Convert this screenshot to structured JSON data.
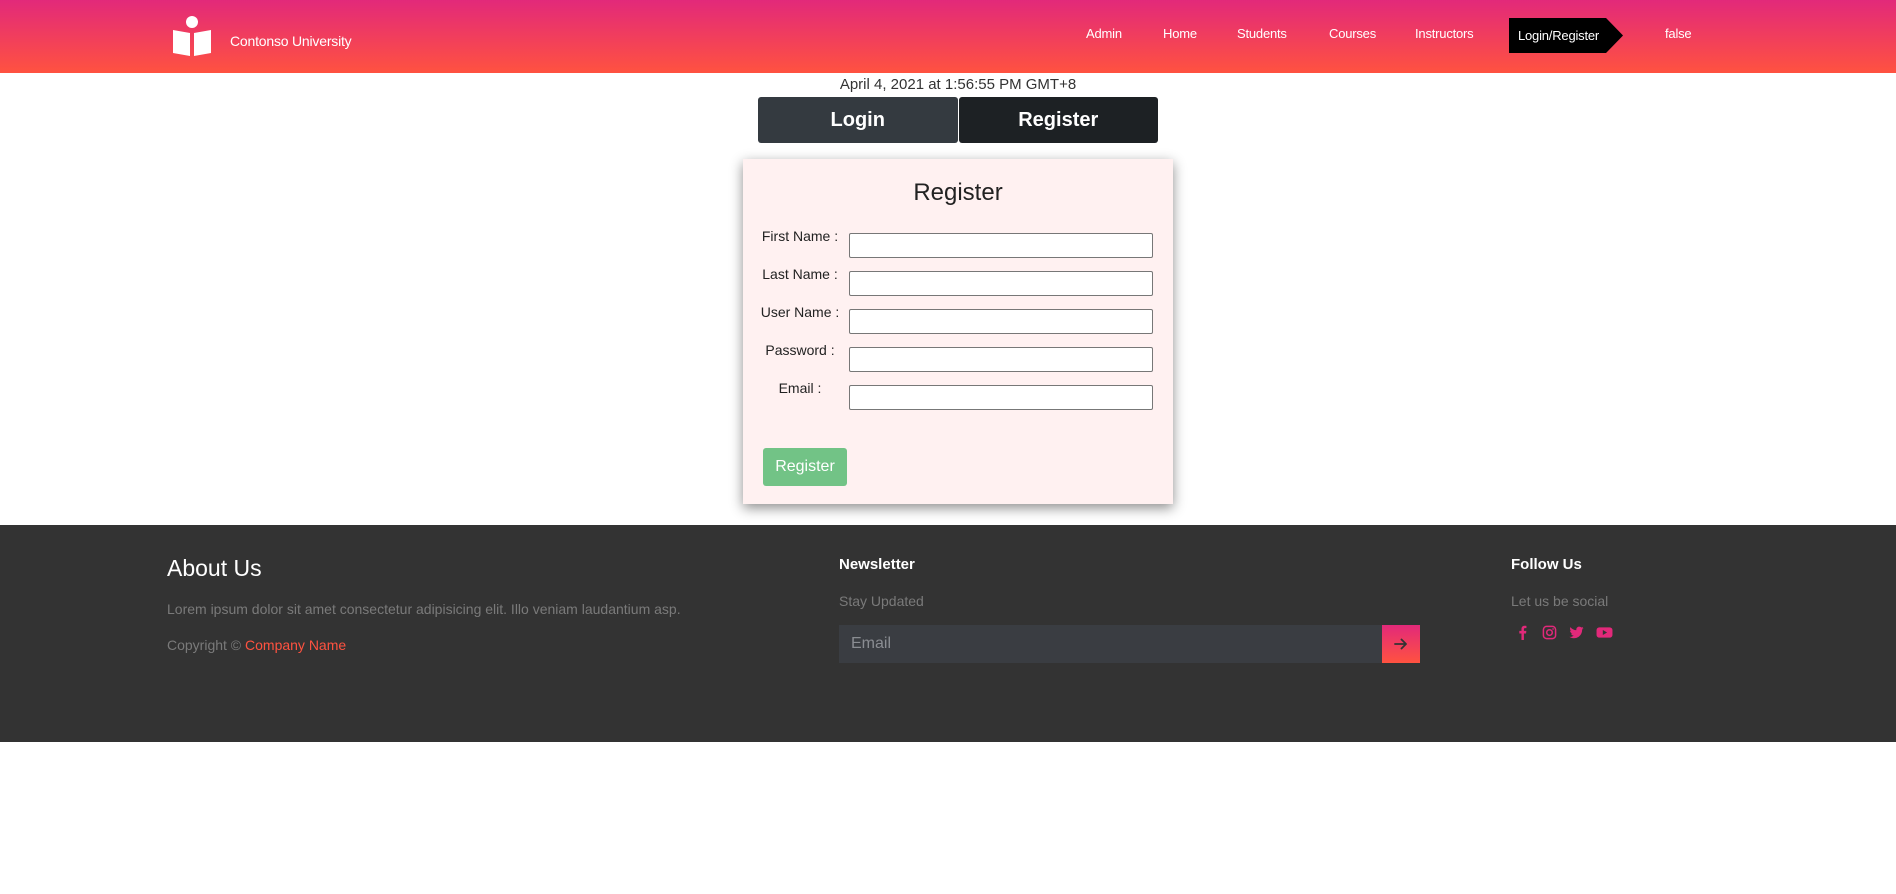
{
  "navbar": {
    "brand": "Contonso University",
    "items": [
      {
        "label": "Admin"
      },
      {
        "label": "Home"
      },
      {
        "label": "Students"
      },
      {
        "label": "Courses"
      },
      {
        "label": "Instructors"
      },
      {
        "label": "Login/Register",
        "active": true
      },
      {
        "label": "false"
      }
    ]
  },
  "datetime": "April 4, 2021 at 1:56:55 PM GMT+8",
  "toggle": {
    "login_label": "Login",
    "register_label": "Register"
  },
  "form": {
    "title": "Register",
    "fields": [
      {
        "label": "First Name :",
        "value": ""
      },
      {
        "label": "Last Name :",
        "value": ""
      },
      {
        "label": "User Name :",
        "value": ""
      },
      {
        "label": "Password :",
        "value": ""
      },
      {
        "label": "Email :",
        "value": ""
      }
    ],
    "submit_label": "Register"
  },
  "footer": {
    "about_title": "About Us",
    "about_text": "Lorem ipsum dolor sit amet consectetur adipisicing elit. Illo veniam laudantium asp.",
    "copyright_prefix": "Copyright © ",
    "company_name": "Company Name",
    "newsletter_title": "Newsletter",
    "newsletter_sub": "Stay Updated",
    "email_placeholder": "Email",
    "follow_title": "Follow Us",
    "follow_sub": "Let us be social",
    "social_icons": [
      "facebook-icon",
      "instagram-icon",
      "twitter-icon",
      "youtube-icon"
    ]
  },
  "colors": {
    "gradient_top": "#e2297a",
    "gradient_bottom": "#ff5240",
    "footer_bg": "#333333",
    "card_bg": "#fff1f1",
    "submit_bg": "#72c386",
    "social_icon": "#e2297a"
  }
}
